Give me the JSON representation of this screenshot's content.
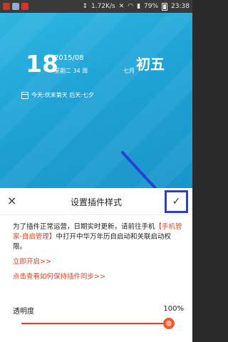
{
  "statusbar": {
    "net_speed": "1.72K/s",
    "battery": "79%",
    "time": "23:38",
    "icons": [
      "app-icon-red",
      "image-icon",
      "app-icon-red",
      "signal-icon",
      "mute-icon",
      "wifi-icon",
      "signal-bars-icon",
      "battery-icon"
    ]
  },
  "widget": {
    "day": "18",
    "year_month": "2015/08",
    "week_info": "星期二  34 周",
    "lunar_month": "七月",
    "lunar_day": "初五",
    "events": "今天:伏末第天  后天:七夕"
  },
  "sheet": {
    "title": "设置插件样式",
    "close_label": "×",
    "confirm_label": "✓",
    "notice_prefix": "为了插件正常运营，日期实时更新，请前往手机",
    "notice_highlight": "【手机管家-自启管理】",
    "notice_suffix": "中打开中华万年历自启动和关联启动权限。",
    "link_open": "立即开启>>",
    "link_help": "点击查看如何保持插件同步>>",
    "opacity_label": "透明度",
    "opacity_value": "100%",
    "opacity_level": 1.0
  },
  "colors": {
    "accent": "#e0411f",
    "highlight_box": "#2b3fd6",
    "wallpaper": "#1fa3d6"
  }
}
